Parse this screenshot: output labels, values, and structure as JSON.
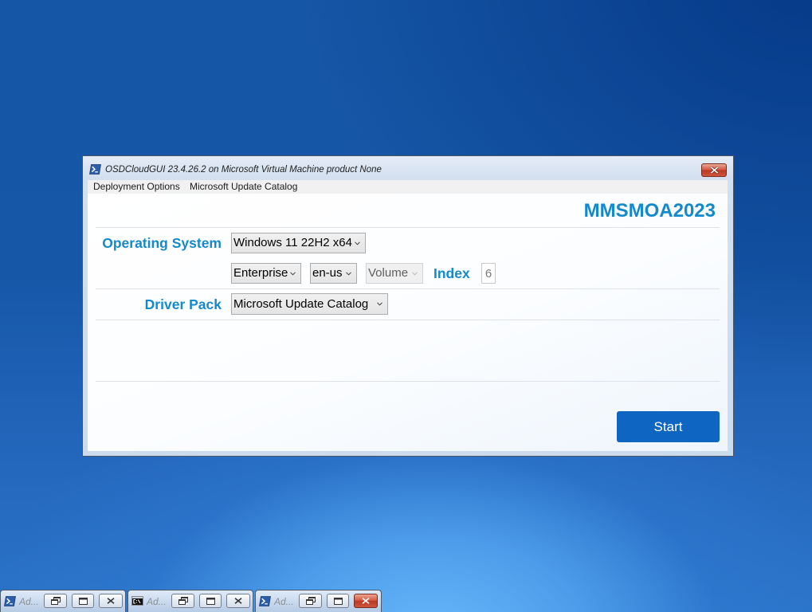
{
  "window": {
    "title": "OSDCloudGUI 23.4.26.2 on Microsoft Virtual Machine product None",
    "app_icon": "powershell-icon",
    "close_icon": "close-icon"
  },
  "menu": {
    "items": [
      {
        "label": "Deployment Options"
      },
      {
        "label": "Microsoft Update Catalog"
      }
    ]
  },
  "header": {
    "brand": "MMSMOA2023"
  },
  "os": {
    "label": "Operating System",
    "name_selected": "Windows 11 22H2 x64",
    "edition_selected": "Enterprise",
    "language_selected": "en-us",
    "activation_selected": "Volume",
    "activation_enabled": false,
    "index_label": "Index",
    "index_value": "6",
    "dropdown_icon": "chevron-down-icon"
  },
  "driver": {
    "label": "Driver Pack",
    "selected": "Microsoft Update Catalog"
  },
  "actions": {
    "start_label": "Start"
  },
  "taskbar": {
    "windows": [
      {
        "icon": "powershell-icon",
        "label": "Ad...",
        "active": false
      },
      {
        "icon": "cmd-icon",
        "label": "Ad...",
        "active": false
      },
      {
        "icon": "powershell-icon",
        "label": "Ad...",
        "active": true
      }
    ]
  },
  "colors": {
    "accent": "#1489cc",
    "start_button": "#0f66c2",
    "close_button": "#d2553f"
  }
}
